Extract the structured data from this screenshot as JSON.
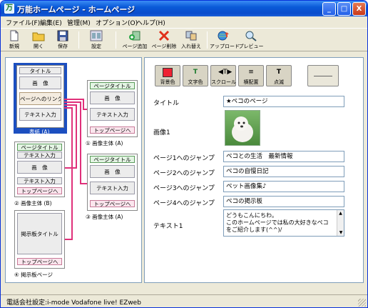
{
  "window": {
    "title": "万能ホームページ - ホームページ",
    "minimize_glyph": "_",
    "maximize_glyph": "□",
    "close_glyph": "X"
  },
  "menu": {
    "file": "ファイル(F)",
    "edit": "編集(E)",
    "manage": "管理(M)",
    "options": "オプション(O)",
    "help": "ヘルプ(H)"
  },
  "toolbar": {
    "new": "新規",
    "open": "開く",
    "save": "保存",
    "settings": "設定",
    "add_page": "ページ追加",
    "delete_page": "ページ削除",
    "swap": "入れ替え",
    "upload": "アップロード",
    "preview": "プレビュー"
  },
  "layout_tree": {
    "cover": {
      "title": "タイトル",
      "image": "画　像",
      "page_link": "ページへのリンク",
      "text_input": "テキスト入力",
      "caption": "表紙 (A)"
    },
    "page1": {
      "title": "ページタイトル",
      "image": "画　像",
      "text_input": "テキスト入力",
      "to_top": "トップページへ",
      "caption": "① 画像主体 (A)"
    },
    "page2": {
      "title": "ページタイトル",
      "text_input_top": "テキスト入力",
      "image": "画　像",
      "text_input_bottom": "テキスト入力",
      "to_top": "トップページへ",
      "caption": "② 画像主体 (B)"
    },
    "page3": {
      "title": "ページタイトル",
      "image": "画　像",
      "text_input": "テキスト入力",
      "to_top": "トップページへ",
      "caption": "③ 画像主体 (A)"
    },
    "page4": {
      "title": "掲示板タイトル",
      "to_top": "トップページへ",
      "caption": "④ 掲示板ページ"
    }
  },
  "format_buttons": {
    "bg_color": "背景色",
    "text_color": "文字色",
    "scroll": "スクロール",
    "align": "横配置",
    "bold": "点滅"
  },
  "form": {
    "title_label": "タイトル",
    "title_value": "★ペコのページ",
    "image_label": "画像1",
    "link1_label": "ページ1へのジャンプ",
    "link1_value": "ペコとの生活　最新情報",
    "link2_label": "ページ2へのジャンプ",
    "link2_value": "ペコの自慢日記",
    "link3_label": "ページ3へのジャンプ",
    "link3_value": "ペット画像集♪",
    "link4_label": "ページ4へのジャンプ",
    "link4_value": "ペコの掲示板",
    "text_label": "テキスト1",
    "text_value_line1": "どうもこんにちわ。",
    "text_value_line2": "このホームページでは私の大好きなペコ",
    "text_value_line3": "をご紹介します(^^)/"
  },
  "status_bar": {
    "text": "電話会社設定:i-mode Vodafone live! EZweb"
  },
  "colors": {
    "title_bar": "#0a4ccc",
    "connector": "#e0307a",
    "selection": "#1c4fc0"
  }
}
